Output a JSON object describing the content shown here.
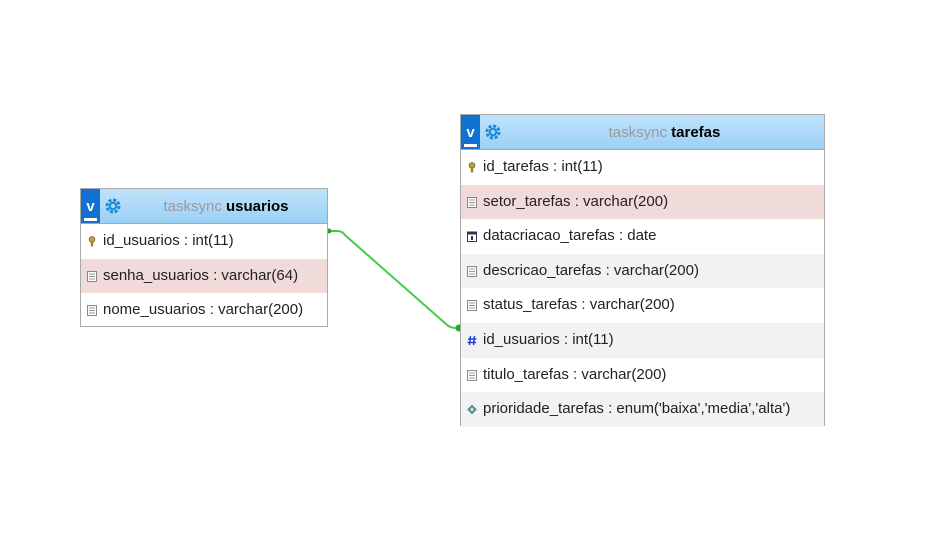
{
  "colors": {
    "link": "#44cc44",
    "header_start": "#bfe3fb",
    "header_end": "#9bd0f6",
    "v_button": "#1270d0",
    "shaded_row": "#f1dada",
    "alt_row": "#f2f2f2"
  },
  "tables": [
    {
      "db": "tasksync",
      "name": "usuarios",
      "toggle": "v",
      "columns": [
        {
          "text": "id_usuarios : int(11)",
          "icon": "key-icon",
          "shade": "none"
        },
        {
          "text": "senha_usuarios : varchar(64)",
          "icon": "text-field-icon",
          "shade": "pink"
        },
        {
          "text": "nome_usuarios : varchar(200)",
          "icon": "text-field-icon",
          "shade": "none"
        }
      ]
    },
    {
      "db": "tasksync",
      "name": "tarefas",
      "toggle": "v",
      "columns": [
        {
          "text": "id_tarefas : int(11)",
          "icon": "key-icon",
          "shade": "none"
        },
        {
          "text": "setor_tarefas : varchar(200)",
          "icon": "text-field-icon",
          "shade": "pink"
        },
        {
          "text": "datacriacao_tarefas : date",
          "icon": "date-icon",
          "shade": "none"
        },
        {
          "text": "descricao_tarefas : varchar(200)",
          "icon": "text-field-icon",
          "shade": "gray"
        },
        {
          "text": "status_tarefas : varchar(200)",
          "icon": "text-field-icon",
          "shade": "none"
        },
        {
          "text": "id_usuarios : int(11)",
          "icon": "number-icon",
          "shade": "gray"
        },
        {
          "text": "titulo_tarefas : varchar(200)",
          "icon": "text-field-icon",
          "shade": "none"
        },
        {
          "text": "prioridade_tarefas : enum('baixa','media','alta')",
          "icon": "enum-icon",
          "shade": "gray"
        }
      ]
    }
  ]
}
